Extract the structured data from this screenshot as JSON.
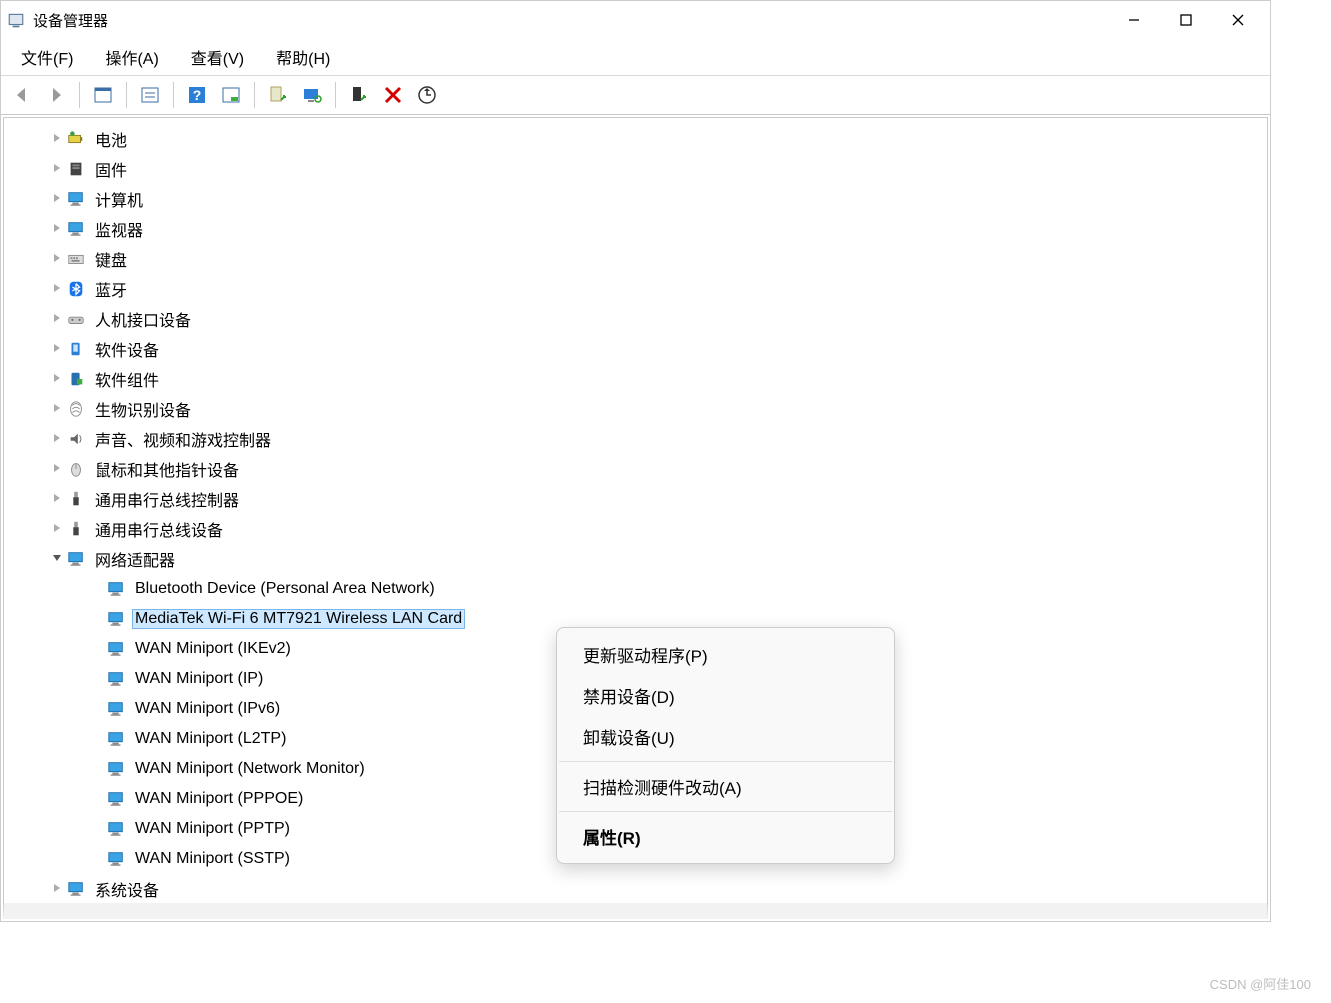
{
  "title": "设备管理器",
  "menu": {
    "file": "文件(F)",
    "action": "操作(A)",
    "view": "查看(V)",
    "help": "帮助(H)"
  },
  "toolbar": {
    "back": "back-icon",
    "forward": "forward-icon",
    "show_hidden": "show-hidden-icon",
    "properties": "properties-icon",
    "help": "help-icon",
    "view": "view-icon",
    "update_driver": "update-driver-icon",
    "scan": "scan-hardware-icon",
    "enable": "enable-device-icon",
    "uninstall": "uninstall-device-icon",
    "refresh": "refresh-icon"
  },
  "tree": {
    "categories": [
      {
        "label": "电池",
        "icon": "battery-icon"
      },
      {
        "label": "固件",
        "icon": "firmware-icon"
      },
      {
        "label": "计算机",
        "icon": "computer-icon"
      },
      {
        "label": "监视器",
        "icon": "monitor-icon"
      },
      {
        "label": "键盘",
        "icon": "keyboard-icon"
      },
      {
        "label": "蓝牙",
        "icon": "bluetooth-icon"
      },
      {
        "label": "人机接口设备",
        "icon": "hid-icon"
      },
      {
        "label": "软件设备",
        "icon": "software-device-icon"
      },
      {
        "label": "软件组件",
        "icon": "software-component-icon"
      },
      {
        "label": "生物识别设备",
        "icon": "biometric-icon"
      },
      {
        "label": "声音、视频和游戏控制器",
        "icon": "sound-icon"
      },
      {
        "label": "鼠标和其他指针设备",
        "icon": "mouse-icon"
      },
      {
        "label": "通用串行总线控制器",
        "icon": "usb-icon"
      },
      {
        "label": "通用串行总线设备",
        "icon": "usb-icon"
      }
    ],
    "network": {
      "label": "网络适配器",
      "icon": "network-adapter-icon",
      "items": [
        {
          "label": "Bluetooth Device (Personal Area Network)"
        },
        {
          "label": "MediaTek Wi-Fi 6 MT7921 Wireless LAN Card",
          "selected": true
        },
        {
          "label": "WAN Miniport (IKEv2)"
        },
        {
          "label": "WAN Miniport (IP)"
        },
        {
          "label": "WAN Miniport (IPv6)"
        },
        {
          "label": "WAN Miniport (L2TP)"
        },
        {
          "label": "WAN Miniport (Network Monitor)"
        },
        {
          "label": "WAN Miniport (PPPOE)"
        },
        {
          "label": "WAN Miniport (PPTP)"
        },
        {
          "label": "WAN Miniport (SSTP)"
        }
      ]
    },
    "last": {
      "label": "系统设备",
      "icon": "system-device-icon"
    }
  },
  "context_menu": {
    "update_driver": "更新驱动程序(P)",
    "disable": "禁用设备(D)",
    "uninstall": "卸载设备(U)",
    "scan": "扫描检测硬件改动(A)",
    "properties": "属性(R)"
  },
  "watermark": "CSDN @阿佳100"
}
